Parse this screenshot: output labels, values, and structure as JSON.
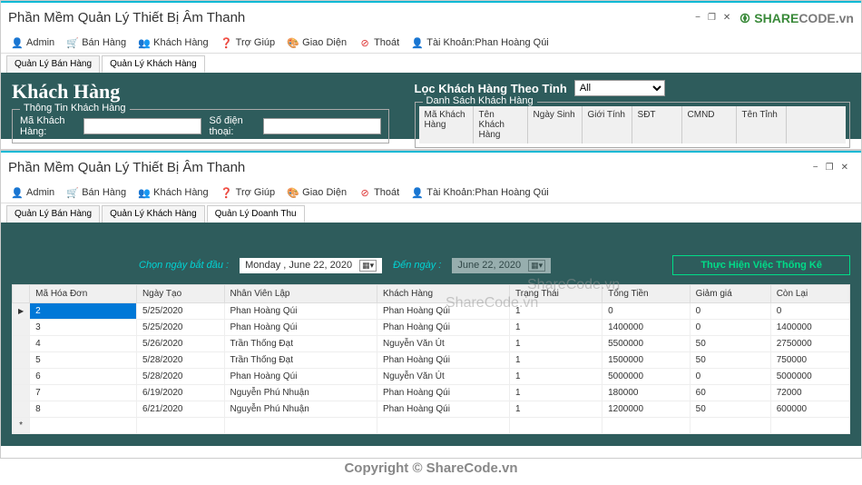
{
  "app_title": "Phần Mềm Quản Lý Thiết Bị Âm Thanh",
  "logo_green": "SHARE",
  "logo_gray": "CODE.vn",
  "win_min": "−",
  "win_max": "❐",
  "win_close": "✕",
  "menu": {
    "admin": "Admin",
    "ban_hang": "Bán Hàng",
    "khach_hang": "Khách Hàng",
    "tro_giup": "Trợ Giúp",
    "giao_dien": "Giao Diện",
    "thoat": "Thoát",
    "tai_khoan": "Tài Khoản:Phan Hoàng Qúi"
  },
  "tabs_w1": {
    "t1": "Quản Lý Bán Hàng",
    "t2": "Quản Lý Khách Hàng"
  },
  "tabs_w2": {
    "t1": "Quản Lý Bán Hàng",
    "t2": "Quản Lý Khách Hàng",
    "t3": "Quản Lý Doanh Thu"
  },
  "w1": {
    "heading": "Khách Hàng",
    "filter_label": "Lọc Khách Hàng Theo Tỉnh",
    "filter_value": "All",
    "fieldset1_legend": "Thông Tin Khách Hàng",
    "lbl_ma": "Mã Khách Hàng:",
    "lbl_sdt": "Số điện thoại:",
    "fieldset2_legend": "Danh Sách Khách Hàng",
    "headers": {
      "h1": "Mã Khách Hàng",
      "h2": "Tên Khách Hàng",
      "h3": "Ngày Sinh",
      "h4": "Giới Tính",
      "h5": "SĐT",
      "h6": "CMND",
      "h7": "Tên Tỉnh"
    }
  },
  "w2": {
    "date_start_label": "Chọn ngày bắt đầu :",
    "date_start_value": "Monday  ,  June     22, 2020",
    "date_end_label": "Đến ngày :",
    "date_end_value": "June     22, 2020",
    "stats_btn": "Thực Hiện Việc Thống Kê",
    "headers": {
      "h1": "Mã Hóa Đơn",
      "h2": "Ngày Tạo",
      "h3": "Nhân Viên Lập",
      "h4": "Khách Hàng",
      "h5": "Trạng Thái",
      "h6": "Tổng Tiền",
      "h7": "Giảm giá",
      "h8": "Còn Lại"
    },
    "rows": [
      {
        "id": "2",
        "date": "5/25/2020",
        "nv": "Phan Hoàng Qúi",
        "kh": "Phan Hoàng Qúi",
        "tt": "1",
        "tong": "0",
        "giam": "0",
        "con": "0"
      },
      {
        "id": "3",
        "date": "5/25/2020",
        "nv": "Phan Hoàng Qúi",
        "kh": "Phan Hoàng Qúi",
        "tt": "1",
        "tong": "1400000",
        "giam": "0",
        "con": "1400000"
      },
      {
        "id": "4",
        "date": "5/26/2020",
        "nv": "Trần Thống Đạt",
        "kh": "Nguyễn Văn Út",
        "tt": "1",
        "tong": "5500000",
        "giam": "50",
        "con": "2750000"
      },
      {
        "id": "5",
        "date": "5/28/2020",
        "nv": "Trần Thống Đạt",
        "kh": "Phan Hoàng Qúi",
        "tt": "1",
        "tong": "1500000",
        "giam": "50",
        "con": "750000"
      },
      {
        "id": "6",
        "date": "5/28/2020",
        "nv": "Phan Hoàng Qúi",
        "kh": "Nguyễn Văn Út",
        "tt": "1",
        "tong": "5000000",
        "giam": "0",
        "con": "5000000"
      },
      {
        "id": "7",
        "date": "6/19/2020",
        "nv": "Nguyễn Phú Nhuận",
        "kh": "Phan Hoàng Qúi",
        "tt": "1",
        "tong": "180000",
        "giam": "60",
        "con": "72000"
      },
      {
        "id": "8",
        "date": "6/21/2020",
        "nv": "Nguyễn Phú Nhuận",
        "kh": "Phan Hoàng Qúi",
        "tt": "1",
        "tong": "1200000",
        "giam": "50",
        "con": "600000"
      }
    ]
  },
  "watermark": "ShareCode.vn",
  "copyright": "Copyright © ShareCode.vn"
}
